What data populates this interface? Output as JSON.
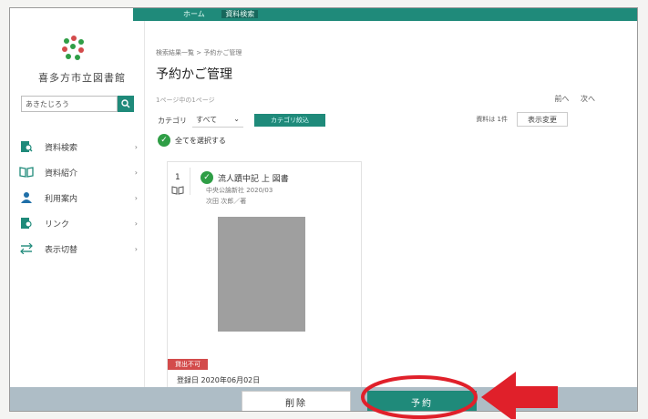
{
  "topnav": {
    "home": "ホーム",
    "active": "資料検索"
  },
  "sidebar": {
    "library_name": "喜多方市立図書館",
    "search_placeholder": "あきたじろう",
    "items": [
      {
        "label": "資料検索",
        "icon": "search-doc-icon"
      },
      {
        "label": "資料紹介",
        "icon": "open-book-icon"
      },
      {
        "label": "利用案内",
        "icon": "person-icon"
      },
      {
        "label": "リンク",
        "icon": "link-doc-icon"
      },
      {
        "label": "表示切替",
        "icon": "toggle-display-icon"
      }
    ]
  },
  "main": {
    "breadcrumb": "検索結果一覧 > 予約かご管理",
    "title": "予約かご管理",
    "page_info": "1ページ中の1ページ",
    "pager_prev": "前へ",
    "pager_next": "次へ",
    "filter_label": "カテゴリ",
    "filter_value": "すべて",
    "filter_apply": "カテゴリ絞込",
    "count_text": "資料は 1件",
    "display_change": "表示変更",
    "select_all": "全てを選択する"
  },
  "item": {
    "index": "1",
    "title": "流人蹟中記 上 図書",
    "publisher": "中央公論新社 2020/03",
    "author": "次田 次郎／著",
    "status_badge": "貸出不可",
    "registered": "登録日 2020年06月02日"
  },
  "actions": {
    "delete": "削除",
    "reserve": "予約"
  },
  "colors": {
    "accent": "#1f8a7a",
    "badge": "#d34b4b",
    "annotation": "#e0202a"
  }
}
